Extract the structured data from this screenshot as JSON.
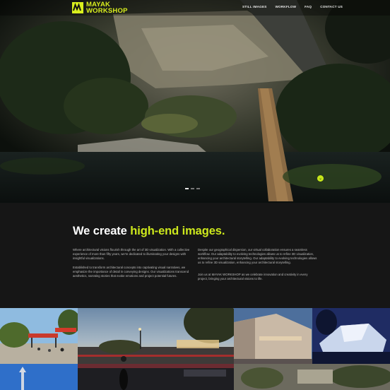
{
  "brand": {
    "name_line1": "MAYAK",
    "name_line2": "WORKSHOP",
    "accent_color": "#d9ef1e"
  },
  "nav": {
    "items": [
      "STILL IMAGES",
      "WORKFLOW",
      "FAQ",
      "CONTACT US"
    ]
  },
  "hero": {
    "slides_total": 3,
    "active_slide": 1,
    "scroll_icon": "chevron-down-icon"
  },
  "intro": {
    "headline_prefix": "We create ",
    "headline_highlight": "high-end images.",
    "paragraphs": [
      "Where architectural visions flourish through the art of 3D visualization. With a collective experience of more than fifty years, we're dedicated to illuminating your designs with insightful visualizations.",
      "Established to transform architectural concepts into captivating visual narratives, we emphasize the importance of detail in conveying designs. Our visualizations transcend aesthetics, narrating stories that evoke emotions and project potential futures.",
      "Despite our geographical dispersion, our virtual collaboration ensures a seamless workflow. Our adaptability to evolving technologies allows us to refine 3D visualization, enhancing your architectural storytelling. Our adaptability to evolving technologies allows us to refine 3D visualization, enhancing your architectural storytelling.",
      "Join us at MAYAK WORKSHOP as we celebrate innovation and creativity in every project, bringing your architectural visions to life."
    ]
  }
}
